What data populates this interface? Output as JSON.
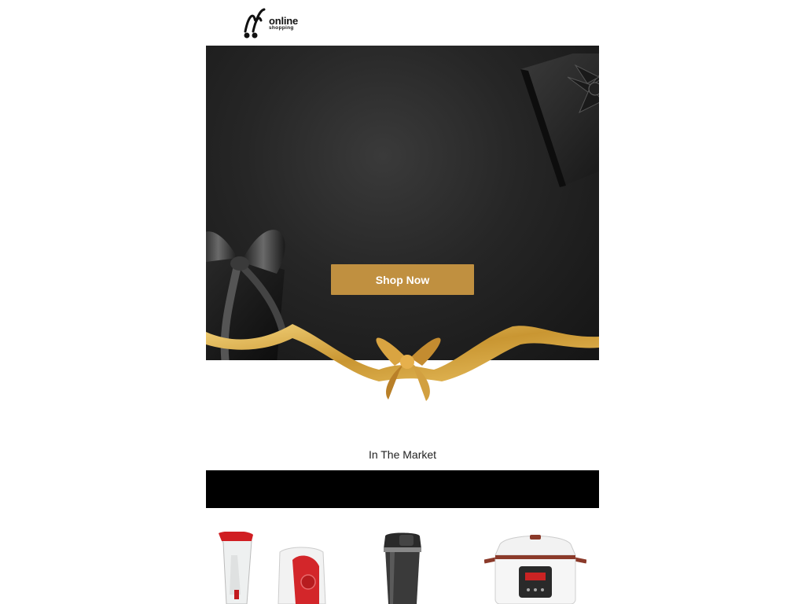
{
  "header": {
    "logo_word": "online",
    "logo_sub": "shopping"
  },
  "hero": {
    "cta_label": "Shop Now"
  },
  "market": {
    "title": "In The Market"
  },
  "products": [
    {
      "icon": "blender-icon"
    },
    {
      "icon": "travel-mug-icon"
    },
    {
      "icon": "pressure-cooker-icon"
    }
  ],
  "colors": {
    "accent_gold": "#c09040",
    "hero_dark": "#1c1c1c",
    "bar_black": "#000000"
  }
}
